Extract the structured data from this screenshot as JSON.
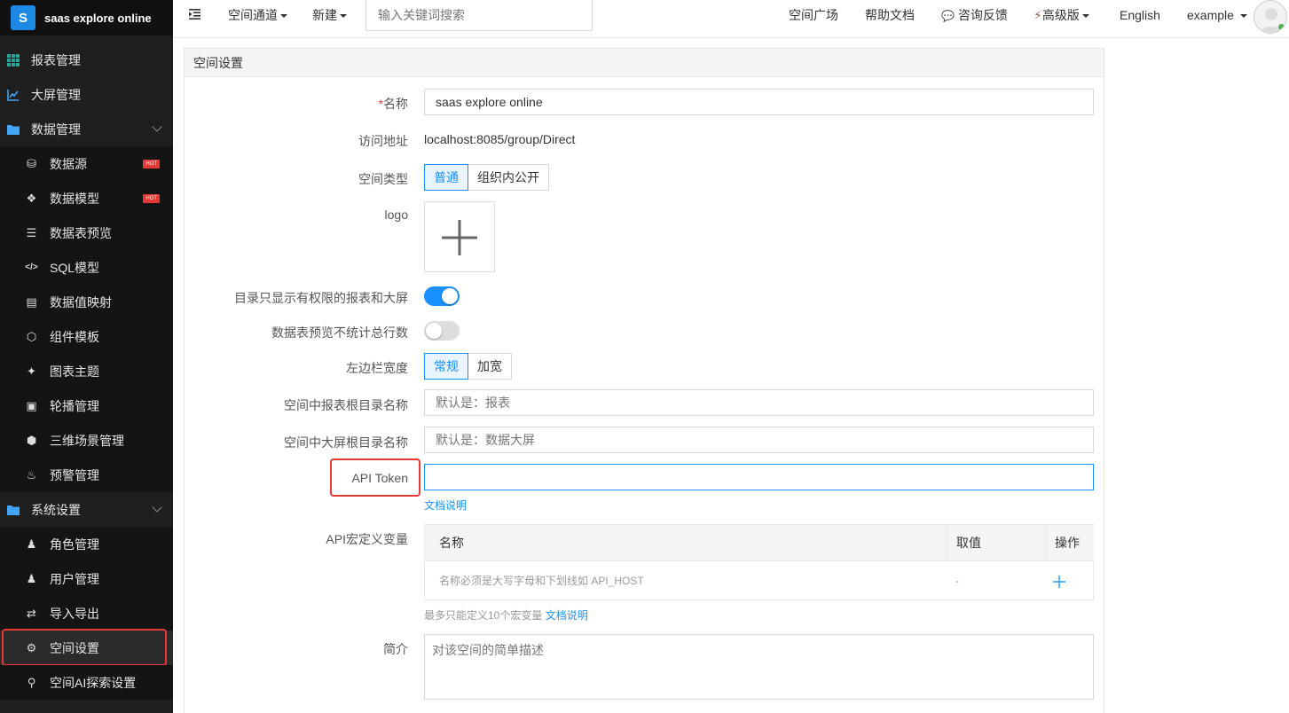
{
  "brand": {
    "logo_letter": "S",
    "name": "saas explore online"
  },
  "sidebar": {
    "items": [
      {
        "label": "报表管理",
        "icon": "grid-icon",
        "level": "top"
      },
      {
        "label": "大屏管理",
        "icon": "line-chart-icon",
        "level": "top"
      },
      {
        "label": "数据管理",
        "icon": "folder-icon",
        "level": "top",
        "expanded": true
      },
      {
        "label": "数据源",
        "icon": "database-icon",
        "level": "sub",
        "badge": "HOT"
      },
      {
        "label": "数据模型",
        "icon": "cubes-icon",
        "level": "sub",
        "badge": "HOT"
      },
      {
        "label": "数据表预览",
        "icon": "list-icon",
        "level": "sub"
      },
      {
        "label": "SQL模型",
        "icon": "code-icon",
        "level": "sub"
      },
      {
        "label": "数据值映射",
        "icon": "book-icon",
        "level": "sub"
      },
      {
        "label": "组件模板",
        "icon": "codepen-icon",
        "level": "sub"
      },
      {
        "label": "图表主题",
        "icon": "magic-wand-icon",
        "level": "sub"
      },
      {
        "label": "轮播管理",
        "icon": "monitor-icon",
        "level": "sub"
      },
      {
        "label": "三维场景管理",
        "icon": "cube-icon",
        "level": "sub"
      },
      {
        "label": "预警管理",
        "icon": "bell-icon",
        "level": "sub"
      },
      {
        "label": "系统设置",
        "icon": "folder-icon",
        "level": "top",
        "expanded": true
      },
      {
        "label": "角色管理",
        "icon": "users-icon",
        "level": "sub"
      },
      {
        "label": "用户管理",
        "icon": "user-icon",
        "level": "sub"
      },
      {
        "label": "导入导出",
        "icon": "exchange-icon",
        "level": "sub"
      },
      {
        "label": "空间设置",
        "icon": "gear-icon",
        "level": "sub",
        "active": true
      },
      {
        "label": "空间AI探索设置",
        "icon": "search-icon",
        "level": "sub"
      }
    ]
  },
  "header": {
    "menu_toggle_icon": "indent-icon",
    "space_channel": "空间通道",
    "new_label": "新建",
    "search_placeholder": "输入关键词搜索",
    "space_plaza": "空间广场",
    "help_docs": "帮助文档",
    "feedback": "咨询反馈",
    "premium": "高级版",
    "language": "English",
    "user": "example"
  },
  "panel": {
    "title": "空间设置",
    "name_label": "名称",
    "name_value": "saas explore online",
    "url_label": "访问地址",
    "url_value": "localhost:8085/group/Direct",
    "type_label": "空间类型",
    "type_options": [
      "普通",
      "组织内公开"
    ],
    "type_selected": "普通",
    "logo_label": "logo",
    "dir_perm_label": "目录只显示有权限的报表和大屏",
    "dir_perm_on": true,
    "no_count_label": "数据表预览不统计总行数",
    "no_count_on": false,
    "sidebar_width_label": "左边栏宽度",
    "sidebar_width_options": [
      "常规",
      "加宽"
    ],
    "sidebar_width_selected": "常规",
    "report_root_label": "空间中报表根目录名称",
    "report_root_placeholder": "默认是：报表",
    "screen_root_label": "空间中大屏根目录名称",
    "screen_root_placeholder": "默认是：数据大屏",
    "api_token_label": "API Token",
    "api_token_value": "",
    "doc_link": "文档说明",
    "api_macro_label": "API宏定义变量",
    "macro_table": {
      "headers": [
        "名称",
        "取值",
        "操作"
      ],
      "row_placeholder_name": "名称必须是大写字母和下划线如 API_HOST",
      "row_placeholder_value": "-",
      "add_icon": "plus-icon"
    },
    "macro_hint": "最多只能定义10个宏变量",
    "macro_doc_link": "文档说明",
    "intro_label": "简介",
    "intro_placeholder": "对该空间的简单描述"
  },
  "colors": {
    "accent": "#1890ff",
    "sidebar_bg": "#1f1f1f",
    "highlight_box": "#e53935",
    "hot_badge": "#e53935"
  }
}
